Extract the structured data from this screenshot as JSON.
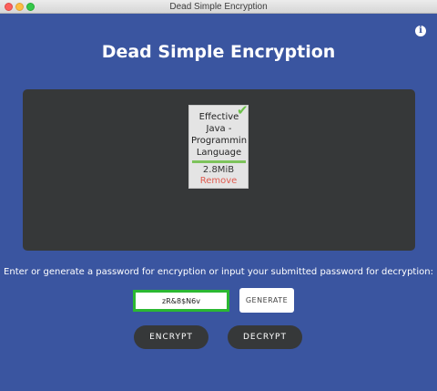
{
  "window": {
    "title": "Dead Simple Encryption"
  },
  "header": {
    "title": "Dead Simple Encryption",
    "info_icon": "info-icon"
  },
  "dropzone": {
    "files": [
      {
        "name": "Effective Java - Programming Language",
        "size": "2.8MiB",
        "remove_label": "Remove",
        "upload_progress": 1.0,
        "complete": true
      }
    ]
  },
  "instructions": "Enter or generate a password for encryption or input your submitted password for decryption:",
  "password": {
    "value": "zR&8$N6v",
    "placeholder": ""
  },
  "buttons": {
    "generate": "GENERATE",
    "encrypt": "ENCRYPT",
    "decrypt": "DECRYPT"
  },
  "colors": {
    "background": "#3a55a0",
    "dropzone": "#363839",
    "accent_green": "#2bb832",
    "remove_red": "#e05a4e"
  }
}
